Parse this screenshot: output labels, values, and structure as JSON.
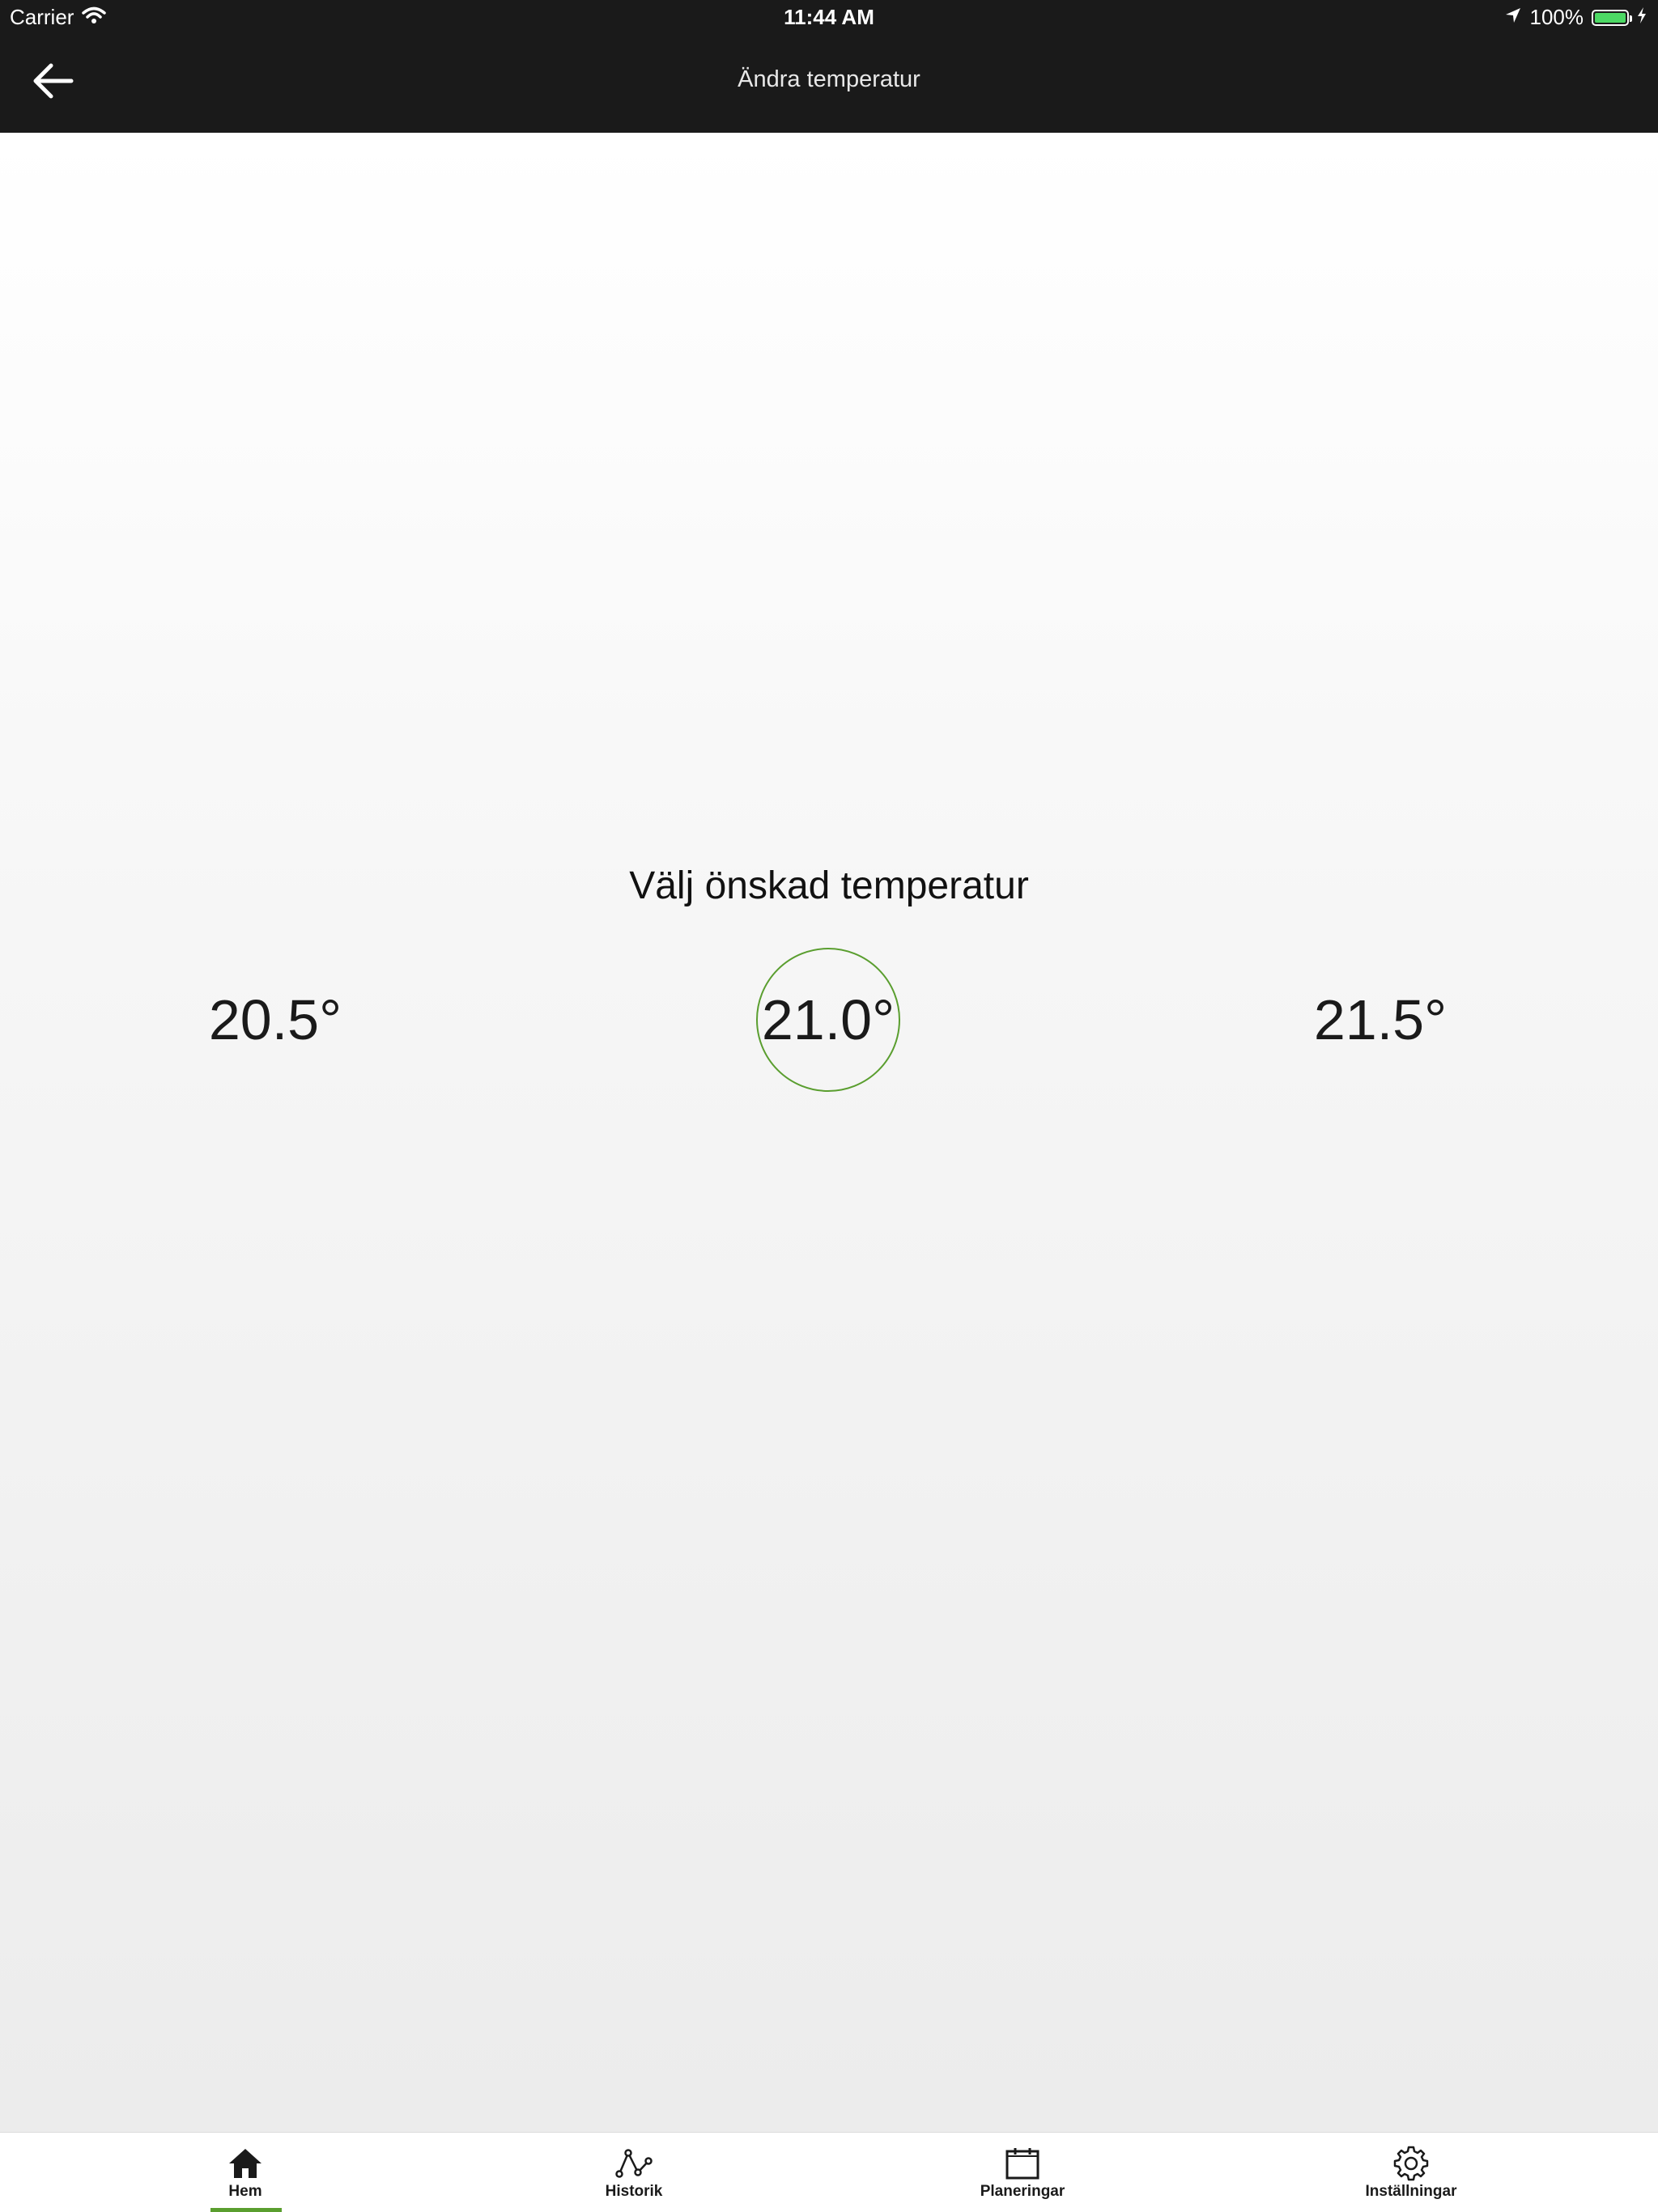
{
  "status_bar": {
    "carrier": "Carrier",
    "time": "11:44 AM",
    "battery_percent": "100%",
    "battery_level": 1.0,
    "icons": [
      "wifi-icon",
      "location-arrow-icon",
      "battery-icon",
      "charging-bolt-icon"
    ]
  },
  "nav": {
    "title": "Ändra temperatur",
    "back_icon": "arrow-left-icon"
  },
  "picker": {
    "prompt": "Välj önskad temperatur",
    "options": [
      "20.5°",
      "21.0°",
      "21.5°"
    ],
    "selected": "21.0°"
  },
  "tabs": [
    {
      "label": "Hem",
      "icon": "home-icon",
      "active": true
    },
    {
      "label": "Historik",
      "icon": "history-chart-icon",
      "active": false
    },
    {
      "label": "Planeringar",
      "icon": "calendar-icon",
      "active": false
    },
    {
      "label": "Inställningar",
      "icon": "gear-icon",
      "active": false
    }
  ],
  "colors": {
    "header_background": "#1a1a1a",
    "accent_green": "#5a9e2f",
    "battery_green": "#4cd964"
  }
}
